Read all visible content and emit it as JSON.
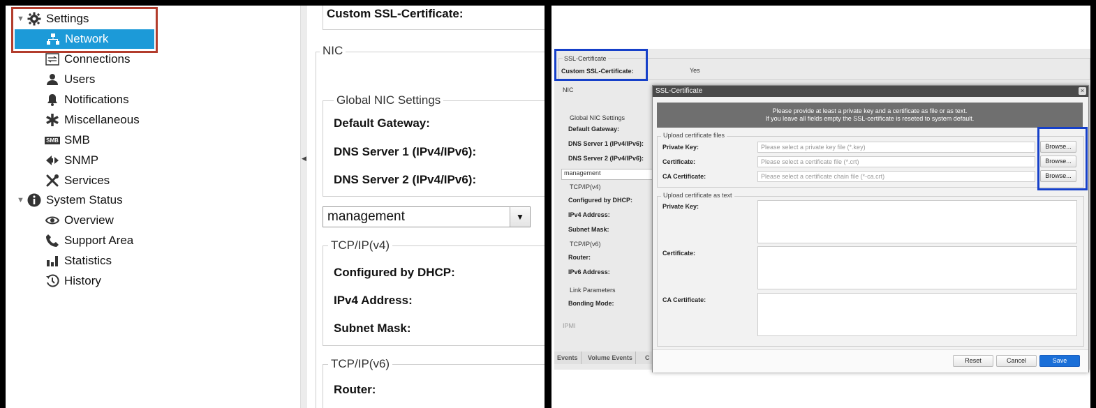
{
  "left": {
    "tree": {
      "settings": "Settings",
      "network": "Network",
      "connections": "Connections",
      "users": "Users",
      "notifications": "Notifications",
      "miscellaneous": "Miscellaneous",
      "smb": "SMB",
      "smb_icon_text": "SMB",
      "snmp": "SNMP",
      "services": "Services",
      "system_status": "System Status",
      "overview": "Overview",
      "support_area": "Support Area",
      "statistics": "Statistics",
      "history": "History"
    },
    "content": {
      "custom_ssl": "Custom SSL-Certificate:",
      "nic_legend": "NIC",
      "global_nic_legend": "Global NIC Settings",
      "default_gateway": "Default Gateway:",
      "dns1": "DNS Server 1 (IPv4/IPv6):",
      "dns2": "DNS Server 2 (IPv4/IPv6):",
      "interface_select": "management",
      "tcpv4_legend": "TCP/IP(v4)",
      "configured_dhcp": "Configured by DHCP:",
      "ipv4_address": "IPv4 Address:",
      "subnet_mask": "Subnet Mask:",
      "tcpv6_legend": "TCP/IP(v6)",
      "router": "Router:"
    }
  },
  "right": {
    "background": {
      "ssl_legend": "SSL-Certificate",
      "custom_ssl": "Custom SSL-Certificate:",
      "custom_ssl_value": "Yes",
      "nic_legend": "NIC",
      "global_nic_legend": "Global NIC Settings",
      "default_gateway": "Default Gateway:",
      "dns1": "DNS Server 1 (IPv4/IPv6):",
      "dns2": "DNS Server 2 (IPv4/IPv6):",
      "interface_select": "management",
      "tcpv4_legend": "TCP/IP(v4)",
      "configured_dhcp": "Configured by DHCP:",
      "ipv4_address": "IPv4 Address:",
      "subnet_mask": "Subnet Mask:",
      "tcpv6_legend": "TCP/IP(v6)",
      "router": "Router:",
      "ipv6_address": "IPv6 Address:",
      "link_params_legend": "Link Parameters",
      "bonding_mode": "Bonding Mode:",
      "ipmi": "IPMI",
      "tabs": [
        "Events",
        "Volume Events",
        "C"
      ]
    },
    "dialog": {
      "title": "SSL-Certificate",
      "close": "×",
      "banner_line1": "Please provide at least a private key and a certificate as file or as text.",
      "banner_line2": "If you leave all fields empty the SSL-certificate is reseted to system default.",
      "files_legend": "Upload certificate files",
      "private_key_label": "Private Key:",
      "private_key_placeholder": "Please select a private key file (*.key)",
      "certificate_label": "Certificate:",
      "certificate_placeholder": "Please select a certificate file (*.crt)",
      "ca_label": "CA Certificate:",
      "ca_placeholder": "Please select a certificate chain file (*-ca.crt)",
      "browse": "Browse...",
      "text_legend": "Upload certificate as text",
      "text_private_key": "Private Key:",
      "text_certificate": "Certificate:",
      "text_ca": "CA Certificate:",
      "reset": "Reset",
      "cancel": "Cancel",
      "save": "Save"
    }
  },
  "colors": {
    "selection": "#1c9ad8",
    "red_highlight": "#b23c2c",
    "blue_highlight": "#1640c9",
    "save_button": "#1a6fd8"
  }
}
